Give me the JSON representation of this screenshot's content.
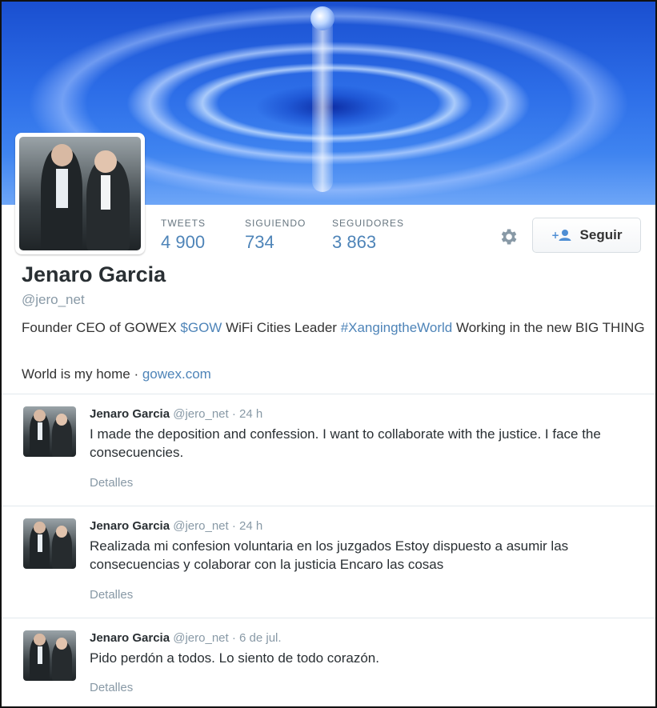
{
  "profile": {
    "name": "Jenaro Garcia",
    "handle": "@jero_net",
    "bio_parts": {
      "p1": "Founder CEO of GOWEX ",
      "cashtag": "$GOW",
      "p2": " WiFi Cities Leader ",
      "hashtag": "#XangingtheWorld",
      "p3": " Working in the new BIG THING"
    },
    "location": "World is my home",
    "separator": " · ",
    "url": "gowex.com"
  },
  "stats": [
    {
      "label": "TWEETS",
      "value": "4 900"
    },
    {
      "label": "SIGUIENDO",
      "value": "734"
    },
    {
      "label": "SEGUIDORES",
      "value": "3 863"
    }
  ],
  "actions": {
    "follow_label": "Seguir",
    "settings_icon": "gear-icon",
    "follow_icon": "add-user-icon"
  },
  "tweets": [
    {
      "name": "Jenaro Garcia",
      "handle": "@jero_net",
      "time": "· 24 h",
      "text": "I made the deposition and confession. I want to collaborate with the justice. I face the consecuencies.",
      "details": "Detalles"
    },
    {
      "name": "Jenaro Garcia",
      "handle": "@jero_net",
      "time": "· 24 h",
      "text": "Realizada mi confesion voluntaria en los juzgados Estoy dispuesto a asumir las consecuencias y colaborar con la justicia Encaro las cosas",
      "details": "Detalles"
    },
    {
      "name": "Jenaro Garcia",
      "handle": "@jero_net",
      "time": "· 6 de jul.",
      "text": "Pido perdón a todos. Lo siento de todo corazón.",
      "details": "Detalles"
    }
  ],
  "colors": {
    "link": "#4e84b8",
    "muted": "#8899a6",
    "text": "#292f33"
  }
}
